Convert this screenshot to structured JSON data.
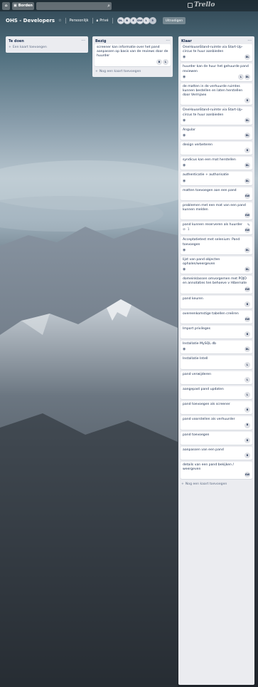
{
  "header": {
    "home_icon": "home-icon",
    "boards_label": "Borden",
    "search_value": "",
    "logo_text": "Trello"
  },
  "board": {
    "title": "OHS - Developers",
    "personal_label": "Persoonlijk",
    "visibility_label": "Privé",
    "members": [
      "DL",
      "B",
      "E",
      "GW",
      "L"
    ],
    "member_count": "5",
    "invite_label": "Uitnodigen"
  },
  "lists": [
    {
      "title": "Te doen",
      "add_label": "Een kaart toevoegen",
      "cards": []
    },
    {
      "title": "Bezig",
      "add_label": "Nog een kaart toevoegen",
      "cards": [
        {
          "title": "screener kan informatie over het pand aanpassen op basis van de reviews door de huurder",
          "watch": false,
          "members": [
            "B",
            "L"
          ]
        }
      ]
    },
    {
      "title": "Klaar",
      "add_label": "Nog een kaart toevoegen",
      "cards": [
        {
          "title": "OneHouseStand-ruimte via Start-Up-circus te huur aanbieden",
          "watch": true,
          "members": [
            "DL"
          ]
        },
        {
          "title": "huurder kan de huur het gehuurde pand reviewen",
          "watch": true,
          "members": [
            "L",
            "DL"
          ]
        },
        {
          "title": "de matten in de verhuurde ruimtes kunnen bestellen en laten herstellen door Vermjaex",
          "watch": false,
          "members": [
            "B"
          ]
        },
        {
          "title": "OneHouseStand-ruimte via Start-Up-circus te huur aanbieden",
          "watch": true,
          "members": [
            "DL"
          ]
        },
        {
          "title": "Angular",
          "watch": true,
          "members": [
            "DL"
          ]
        },
        {
          "title": "design verbeteren",
          "watch": false,
          "members": [
            "B"
          ]
        },
        {
          "title": "syndicus kan een mat herstellen",
          "watch": true,
          "members": [
            "DL"
          ]
        },
        {
          "title": "authenticatie + authorisatie",
          "watch": true,
          "members": [
            "DL"
          ]
        },
        {
          "title": "matten toevoegen aan een pand",
          "watch": false,
          "members": [
            "GW"
          ]
        },
        {
          "title": "problemen met een mat van een pand kunnen melden",
          "watch": false,
          "members": [
            "GW"
          ]
        },
        {
          "title": "pand kunnen reserveren als huurder",
          "watch": false,
          "attachments": "1",
          "members": [
            "GW"
          ],
          "edit": true
        },
        {
          "title": "Acceptatietest met selenium: Pand toevoegen",
          "watch": true,
          "members": [
            "DL"
          ]
        },
        {
          "title": "lijst van pand objecten ophalen/weergeven",
          "watch": true,
          "members": [
            "DL"
          ]
        },
        {
          "title": "domeinklassen omvorgemen met POJO en annotaties ten behoeve v Hibernate",
          "watch": false,
          "members": [
            "GW"
          ]
        },
        {
          "title": "pand keuren",
          "watch": false,
          "members": [
            "B"
          ]
        },
        {
          "title": "overeenkomstige tabellen creëren",
          "watch": false,
          "members": [
            "GW"
          ]
        },
        {
          "title": "Import privileges",
          "watch": false,
          "members": [
            "B"
          ]
        },
        {
          "title": "Installatie MySQL db",
          "watch": true,
          "members": [
            "DL"
          ]
        },
        {
          "title": "Installatie Intell",
          "watch": false,
          "members": [
            "L"
          ]
        },
        {
          "title": "pand verwijderen",
          "watch": false,
          "members": [
            "L"
          ]
        },
        {
          "title": "aangepast pand updaten",
          "watch": false,
          "members": [
            "L"
          ]
        },
        {
          "title": "pand toevoegen als screener",
          "watch": false,
          "members": [
            "B"
          ]
        },
        {
          "title": "pand voorstellen als verhuurder",
          "watch": false,
          "members": [
            "B"
          ]
        },
        {
          "title": "pand toevoegen",
          "watch": false,
          "members": [
            "B"
          ]
        },
        {
          "title": "aanpassen van een pand",
          "watch": false,
          "members": [
            "B"
          ]
        },
        {
          "title": "details van een pand bekijken / weergeven",
          "watch": false,
          "members": [
            "GW"
          ]
        }
      ]
    }
  ]
}
